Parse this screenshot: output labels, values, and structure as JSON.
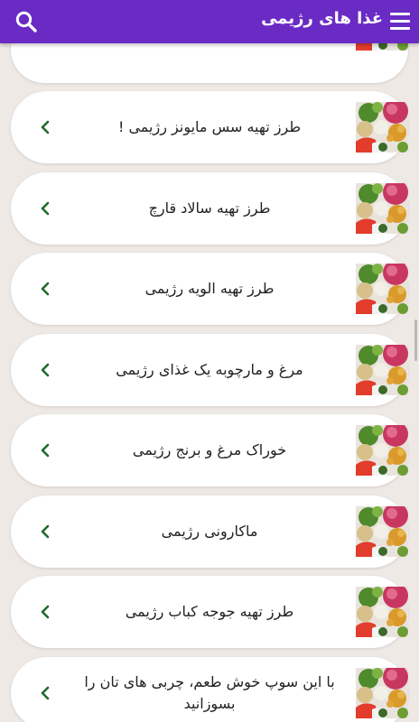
{
  "app": {
    "title": "غذا های رژیمی",
    "menu_icon": "hamburger-menu-icon",
    "search_icon": "search-icon",
    "accent": "#6a2bc4"
  },
  "list": {
    "items": [
      {
        "label": "طرز تهیه سس مایونز رژیمی !"
      },
      {
        "label": "طرز تهیه سالاد قارچ"
      },
      {
        "label": "طرز تهیه الویه رژیمی"
      },
      {
        "label": "مرغ و مارچوبه یک غذای رژیمی"
      },
      {
        "label": "خوراک مرغ و برنج رژیمی"
      },
      {
        "label": "ماکارونی رژیمی"
      },
      {
        "label": "طرز تهیه جوجه کباب رژیمی"
      },
      {
        "label": "با این سوپ خوش طعم، چربی های تان را بسوزانید"
      }
    ]
  }
}
